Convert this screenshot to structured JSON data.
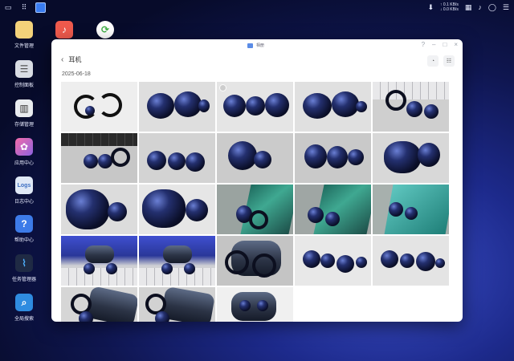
{
  "taskbar": {
    "left_icons": [
      "window-icon",
      "apps-grid-icon",
      "file-manager-active-icon"
    ],
    "speed_up": "↑ 0.1 KB/s",
    "speed_down": "↓ 0.0 KB/s"
  },
  "desktop": {
    "items": [
      {
        "name": "文件管理",
        "icon": "folder-icon",
        "color": "#f4d27a"
      },
      {
        "name": "控制面板",
        "icon": "control-panel-icon",
        "color": "#d9dde4"
      },
      {
        "name": "存储管理",
        "icon": "storage-icon",
        "color": "#e9ecef"
      },
      {
        "name": "应用中心",
        "icon": "app-center-icon",
        "color": "#c77ad9"
      },
      {
        "name": "日志中心",
        "icon": "log-icon",
        "color": "#dfe8f6"
      },
      {
        "name": "帮助中心",
        "icon": "help-icon",
        "color": "#3d7be8"
      },
      {
        "name": "任务管理器",
        "icon": "task-manager-icon",
        "color": "#1f2a44"
      },
      {
        "name": "全局搜索",
        "icon": "search-icon",
        "color": "#2f8ce0"
      }
    ],
    "top_apps": [
      {
        "icon": "music-app-icon",
        "color": "#ef5a4d"
      },
      {
        "icon": "sync-app-icon",
        "color": "#3fae44"
      }
    ]
  },
  "window": {
    "app_label": "相册",
    "controls": [
      "?",
      "–",
      "□",
      "×"
    ],
    "nav": {
      "back": "‹",
      "title": "耳机"
    },
    "date": "2025-06-18",
    "photos": [
      "earbud-photo",
      "earbud-photo",
      "earbud-photo",
      "earbud-photo",
      "earbud-keyboard-photo",
      "earbud-keyboard-photo",
      "earbud-photo",
      "earbud-photo",
      "earbud-photo",
      "earbud-photo",
      "earbud-closeup-photo",
      "earbud-closeup-photo",
      "earbud-screen-photo",
      "earbud-screen-photo",
      "earbud-screen-photo",
      "case-keyboard-photo",
      "case-keyboard-photo",
      "case-closeup-photo",
      "earbud-photo",
      "earbud-photo",
      "earbud-case-photo",
      "earbud-case-photo",
      "case-photo"
    ]
  }
}
